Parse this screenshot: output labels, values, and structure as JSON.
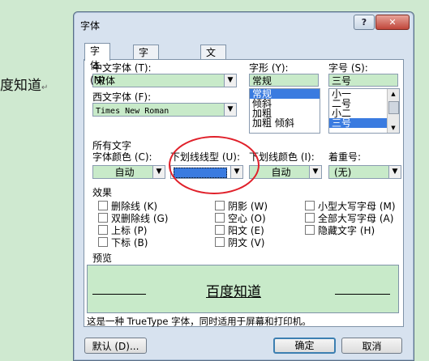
{
  "background_text": "度知道",
  "background_mark": "↵",
  "dialog": {
    "title": "字体",
    "help_icon": "?",
    "close_icon": "✕",
    "tabs": [
      "字体 (N)",
      "字符间距 (R)",
      "文字效果 (X)"
    ],
    "chinese_font_label": "中文字体 (T):",
    "chinese_font_value": "宋体",
    "western_font_label": "西文字体 (F):",
    "western_font_value": "Times New Roman",
    "style_label": "字形 (Y):",
    "style_value": "常规",
    "style_options": [
      "常规",
      "倾斜",
      "加粗",
      "加粗 倾斜"
    ],
    "size_label": "字号 (S):",
    "size_value": "三号",
    "size_options": [
      "小一",
      "二号",
      "小二",
      "三号"
    ],
    "all_text_label": "所有文字",
    "font_color_label": "字体颜色 (C):",
    "font_color_value": "自动",
    "underline_type_label": "下划线线型 (U):",
    "underline_type_value": "———————",
    "underline_color_label": "下划线颜色 (I):",
    "underline_color_value": "自动",
    "emphasis_label": "着重号:",
    "emphasis_value": "(无)",
    "effects_label": "效果",
    "effects_col1": [
      "删除线 (K)",
      "双删除线 (G)",
      "上标 (P)",
      "下标 (B)"
    ],
    "effects_col2": [
      "阴影 (W)",
      "空心 (O)",
      "阳文 (E)",
      "阴文 (V)"
    ],
    "effects_col3": [
      "小型大写字母 (M)",
      "全部大写字母 (A)",
      "隐藏文字 (H)"
    ],
    "preview_label": "预览",
    "preview_text": "百度知道",
    "note": "这是一种 TrueType 字体，同时适用于屏幕和打印机。",
    "default_button": "默认 (D)...",
    "ok_button": "确定",
    "cancel_button": "取消"
  },
  "colors": {
    "field_bg": "#c8eac9",
    "page_bg": "#cfe9d0",
    "selection": "#3a7be0",
    "highlight_oval": "#e0202a"
  }
}
